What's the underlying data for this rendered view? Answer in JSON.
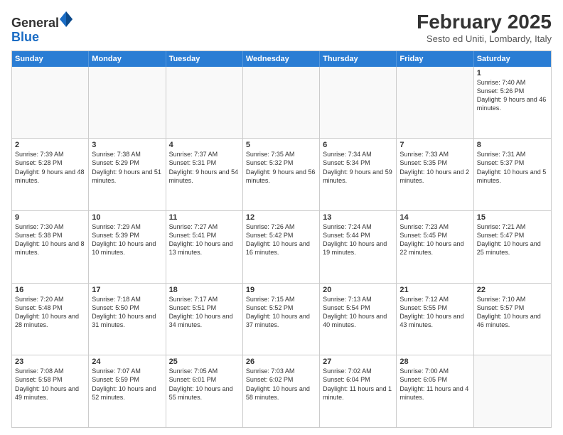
{
  "header": {
    "logo_general": "General",
    "logo_blue": "Blue",
    "month_year": "February 2025",
    "location": "Sesto ed Uniti, Lombardy, Italy"
  },
  "days_of_week": [
    "Sunday",
    "Monday",
    "Tuesday",
    "Wednesday",
    "Thursday",
    "Friday",
    "Saturday"
  ],
  "rows": [
    [
      {
        "day": "",
        "info": ""
      },
      {
        "day": "",
        "info": ""
      },
      {
        "day": "",
        "info": ""
      },
      {
        "day": "",
        "info": ""
      },
      {
        "day": "",
        "info": ""
      },
      {
        "day": "",
        "info": ""
      },
      {
        "day": "1",
        "info": "Sunrise: 7:40 AM\nSunset: 5:26 PM\nDaylight: 9 hours and 46 minutes."
      }
    ],
    [
      {
        "day": "2",
        "info": "Sunrise: 7:39 AM\nSunset: 5:28 PM\nDaylight: 9 hours and 48 minutes."
      },
      {
        "day": "3",
        "info": "Sunrise: 7:38 AM\nSunset: 5:29 PM\nDaylight: 9 hours and 51 minutes."
      },
      {
        "day": "4",
        "info": "Sunrise: 7:37 AM\nSunset: 5:31 PM\nDaylight: 9 hours and 54 minutes."
      },
      {
        "day": "5",
        "info": "Sunrise: 7:35 AM\nSunset: 5:32 PM\nDaylight: 9 hours and 56 minutes."
      },
      {
        "day": "6",
        "info": "Sunrise: 7:34 AM\nSunset: 5:34 PM\nDaylight: 9 hours and 59 minutes."
      },
      {
        "day": "7",
        "info": "Sunrise: 7:33 AM\nSunset: 5:35 PM\nDaylight: 10 hours and 2 minutes."
      },
      {
        "day": "8",
        "info": "Sunrise: 7:31 AM\nSunset: 5:37 PM\nDaylight: 10 hours and 5 minutes."
      }
    ],
    [
      {
        "day": "9",
        "info": "Sunrise: 7:30 AM\nSunset: 5:38 PM\nDaylight: 10 hours and 8 minutes."
      },
      {
        "day": "10",
        "info": "Sunrise: 7:29 AM\nSunset: 5:39 PM\nDaylight: 10 hours and 10 minutes."
      },
      {
        "day": "11",
        "info": "Sunrise: 7:27 AM\nSunset: 5:41 PM\nDaylight: 10 hours and 13 minutes."
      },
      {
        "day": "12",
        "info": "Sunrise: 7:26 AM\nSunset: 5:42 PM\nDaylight: 10 hours and 16 minutes."
      },
      {
        "day": "13",
        "info": "Sunrise: 7:24 AM\nSunset: 5:44 PM\nDaylight: 10 hours and 19 minutes."
      },
      {
        "day": "14",
        "info": "Sunrise: 7:23 AM\nSunset: 5:45 PM\nDaylight: 10 hours and 22 minutes."
      },
      {
        "day": "15",
        "info": "Sunrise: 7:21 AM\nSunset: 5:47 PM\nDaylight: 10 hours and 25 minutes."
      }
    ],
    [
      {
        "day": "16",
        "info": "Sunrise: 7:20 AM\nSunset: 5:48 PM\nDaylight: 10 hours and 28 minutes."
      },
      {
        "day": "17",
        "info": "Sunrise: 7:18 AM\nSunset: 5:50 PM\nDaylight: 10 hours and 31 minutes."
      },
      {
        "day": "18",
        "info": "Sunrise: 7:17 AM\nSunset: 5:51 PM\nDaylight: 10 hours and 34 minutes."
      },
      {
        "day": "19",
        "info": "Sunrise: 7:15 AM\nSunset: 5:52 PM\nDaylight: 10 hours and 37 minutes."
      },
      {
        "day": "20",
        "info": "Sunrise: 7:13 AM\nSunset: 5:54 PM\nDaylight: 10 hours and 40 minutes."
      },
      {
        "day": "21",
        "info": "Sunrise: 7:12 AM\nSunset: 5:55 PM\nDaylight: 10 hours and 43 minutes."
      },
      {
        "day": "22",
        "info": "Sunrise: 7:10 AM\nSunset: 5:57 PM\nDaylight: 10 hours and 46 minutes."
      }
    ],
    [
      {
        "day": "23",
        "info": "Sunrise: 7:08 AM\nSunset: 5:58 PM\nDaylight: 10 hours and 49 minutes."
      },
      {
        "day": "24",
        "info": "Sunrise: 7:07 AM\nSunset: 5:59 PM\nDaylight: 10 hours and 52 minutes."
      },
      {
        "day": "25",
        "info": "Sunrise: 7:05 AM\nSunset: 6:01 PM\nDaylight: 10 hours and 55 minutes."
      },
      {
        "day": "26",
        "info": "Sunrise: 7:03 AM\nSunset: 6:02 PM\nDaylight: 10 hours and 58 minutes."
      },
      {
        "day": "27",
        "info": "Sunrise: 7:02 AM\nSunset: 6:04 PM\nDaylight: 11 hours and 1 minute."
      },
      {
        "day": "28",
        "info": "Sunrise: 7:00 AM\nSunset: 6:05 PM\nDaylight: 11 hours and 4 minutes."
      },
      {
        "day": "",
        "info": ""
      }
    ]
  ]
}
